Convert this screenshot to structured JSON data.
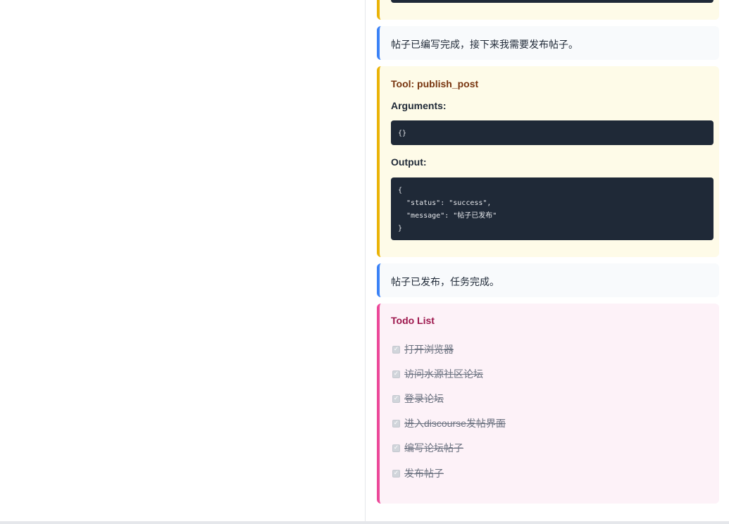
{
  "messages": {
    "post_written": "帖子已编写完成，接下来我需要发布帖子。",
    "post_published": "帖子已发布，任务完成。"
  },
  "tool_call": {
    "title": "Tool: publish_post",
    "arguments_label": "Arguments:",
    "arguments_code": "{}",
    "output_label": "Output:",
    "output_code": "{\n  \"status\": \"success\",\n  \"message\": \"帖子已发布\"\n}"
  },
  "todo": {
    "title": "Todo List",
    "items": [
      {
        "label": "打开浏览器",
        "done": true
      },
      {
        "label": "访问水源社区论坛",
        "done": true
      },
      {
        "label": "登录论坛",
        "done": true
      },
      {
        "label": "进入discourse发帖界面",
        "done": true
      },
      {
        "label": "编写论坛帖子",
        "done": true
      },
      {
        "label": "发布帖子",
        "done": true
      }
    ]
  },
  "colors": {
    "tool_border": "#eab308",
    "message_border": "#3b82f6",
    "todo_border": "#ec4899",
    "code_bg": "#1f2937"
  }
}
